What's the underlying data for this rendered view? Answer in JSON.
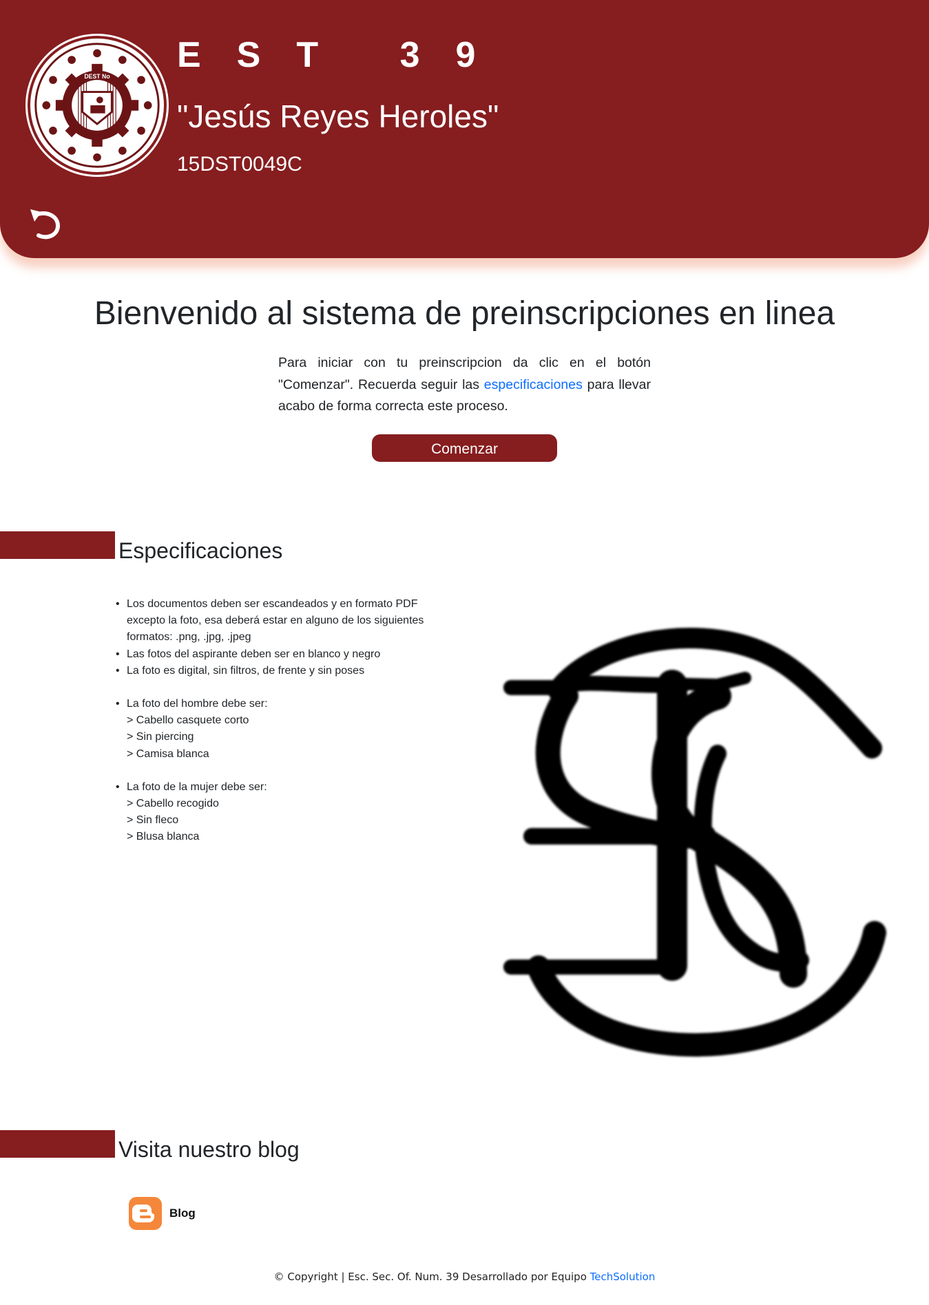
{
  "header": {
    "title": "EST 39",
    "subtitle": "\"Jesús Reyes Heroles\"",
    "code": "15DST0049C",
    "logo_text": "DEST No",
    "back_icon": "undo-arrow-icon"
  },
  "welcome": {
    "title": "Bienvenido al sistema de preinscripciones en linea",
    "intro_before": "Para iniciar con tu preinscripcion da clic en el botón \"Comenzar\". Recuerda seguir las ",
    "intro_link": "especificaciones",
    "intro_after": " para llevar acabo de forma correcta este proceso.",
    "start_label": "Comenzar"
  },
  "specs": {
    "title": "Especificaciones",
    "items": [
      "Los documentos deben ser escandeados y en formato PDF excepto la foto, esa deberá estar en alguno de los siguientes formatos: .png, .jpg, .jpeg",
      "Las fotos del aspirante deben ser en blanco y negro",
      "La foto es digital, sin filtros, de frente y sin poses"
    ],
    "male": {
      "heading": "La foto del hombre debe ser:",
      "lines": [
        "> Cabello casquete corto",
        "> Sin piercing",
        "> Camisa blanca"
      ]
    },
    "female": {
      "heading": "La foto de la mujer debe ser:",
      "lines": [
        "> Cabello recogido",
        "> Sin fleco",
        "> Blusa blanca"
      ]
    }
  },
  "blog": {
    "title": "Visita nuestro blog",
    "link_label": "Blog",
    "icon": "blogger-icon"
  },
  "footer": {
    "text": "© Copyright | Esc. Sec. Of. Num. 39 Desarrollado por Equipo ",
    "link": "TechSolution"
  },
  "colors": {
    "primary": "#861d1f",
    "link": "#0d6efd",
    "blogger": "#f5873b"
  }
}
